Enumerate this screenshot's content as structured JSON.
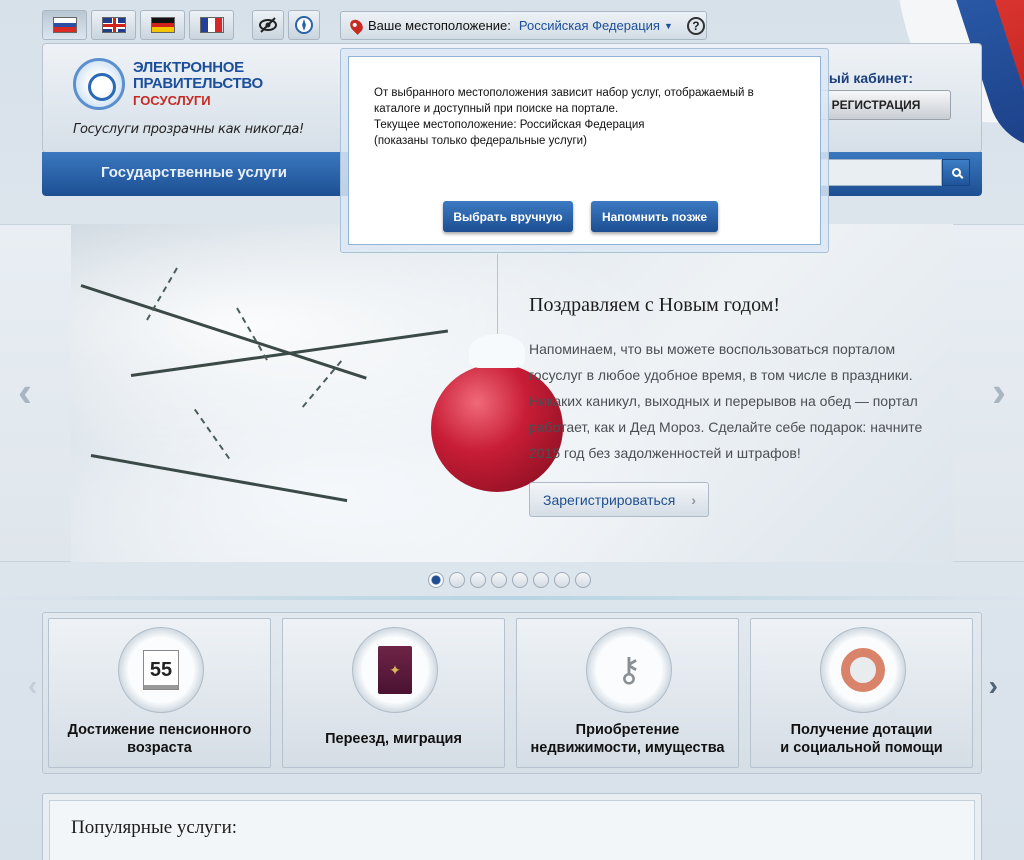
{
  "languages": [
    {
      "code": "ru",
      "active": true
    },
    {
      "code": "uk",
      "active": false
    },
    {
      "code": "de",
      "active": false
    },
    {
      "code": "fr",
      "active": false
    }
  ],
  "tools": {
    "accessibility_icon": "eye-icon",
    "compass_icon": "compass-icon"
  },
  "location": {
    "label": "Ваше местоположение:",
    "value": "Российская Федерация",
    "help": "?"
  },
  "logo": {
    "line1": "ЭЛЕКТРОННОЕ",
    "line2": "ПРАВИТЕЛЬСТВО",
    "line3": "ГОСУСЛУГИ",
    "slogan": "Госуслуги прозрачны как никогда!"
  },
  "cabinet": {
    "title": "ый кабинет:",
    "register": "РЕГИСТРАЦИЯ"
  },
  "nav": {
    "item": "Государственные услуги"
  },
  "modal": {
    "line1": "От выбранного местоположения зависит набор услуг, отображаемый в каталоге и доступный при поиске на портале.",
    "line2": "Текущее местоположение: Российская Федерация",
    "line3": "(показаны только федеральные услуги)",
    "btn_manual": "Выбрать вручную",
    "btn_later": "Напомнить позже"
  },
  "banner": {
    "title": "Поздравляем с Новым годом!",
    "text": "Напоминаем, что вы можете воспользоваться порталом госуслуг в любое удобное время, в том числе в праздники. Никаких каникул, выходных и перерывов на обед — портал работает, как и Дед Мороз. Сделайте себе подарок: начните 2015 год без задолженностей и штрафов!",
    "button": "Зарегистрироваться",
    "active_slide": 1,
    "slide_count": 8
  },
  "categories": [
    {
      "line1": "Достижение пенсионного",
      "line2": "возраста",
      "icon": "calendar-icon",
      "icon_text": "55"
    },
    {
      "line1": "",
      "line2": "Переезд, миграция",
      "icon": "passport-icon"
    },
    {
      "line1": "Приобретение",
      "line2": "недвижимости, имущества",
      "icon": "keys-icon"
    },
    {
      "line1": "Получение дотации",
      "line2": "и социальной помощи",
      "icon": "lifebuoy-icon"
    }
  ],
  "popular": {
    "title": "Популярные услуги:"
  },
  "colors": {
    "brand_blue": "#1b4f9c",
    "brand_red": "#c62a22",
    "nav_blue": "#2a64ab"
  }
}
